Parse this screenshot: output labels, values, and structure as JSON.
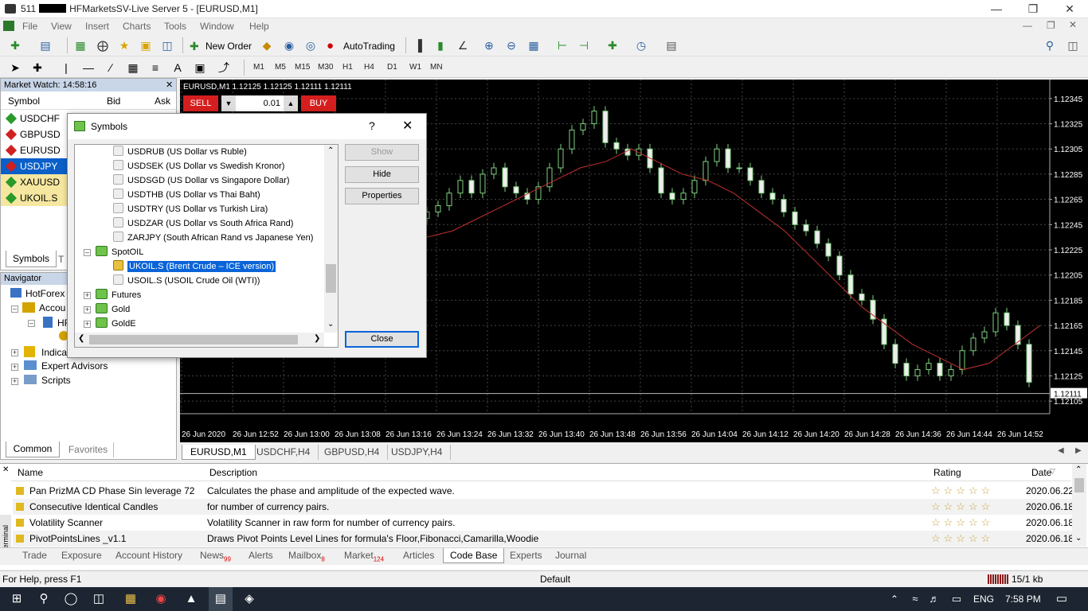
{
  "window": {
    "title_prefix": "511",
    "title": "HFMarketsSV-Live Server 5 - [EURUSD,M1]"
  },
  "menu": [
    "File",
    "View",
    "Insert",
    "Charts",
    "Tools",
    "Window",
    "Help"
  ],
  "toolbar": {
    "new_order": "New Order",
    "autotrading": "AutoTrading"
  },
  "timeframes": [
    "M1",
    "M5",
    "M15",
    "M30",
    "H1",
    "H4",
    "D1",
    "W1",
    "MN"
  ],
  "market_watch": {
    "title": "Market Watch: 14:58:16",
    "col_symbol": "Symbol",
    "col_bid": "Bid",
    "col_ask": "Ask",
    "rows": [
      {
        "symbol": "USDCHF",
        "dir": "up"
      },
      {
        "symbol": "GBPUSD",
        "dir": "down"
      },
      {
        "symbol": "EURUSD",
        "dir": "down"
      },
      {
        "symbol": "USDJPY",
        "dir": "down"
      },
      {
        "symbol": "XAUUSD",
        "dir": "up"
      },
      {
        "symbol": "UKOIL.S",
        "dir": "up"
      }
    ],
    "tab_symbols": "Symbols",
    "tab_t": "T"
  },
  "navigator": {
    "title": "Navigator",
    "root": "HotForex",
    "accounts": "Accou",
    "account_item": "HF",
    "indicators": "Indica",
    "experts": "Expert Advisors",
    "scripts": "Scripts",
    "tab_common": "Common",
    "tab_favorites": "Favorites"
  },
  "chart": {
    "header": "EURUSD,M1  1.12125 1.12125 1.12111 1.12111",
    "sell": "SELL",
    "buy": "BUY",
    "lot": "0.01",
    "price_labels": [
      "1.12345",
      "1.12325",
      "1.12305",
      "1.12285",
      "1.12265",
      "1.12245",
      "1.12225",
      "1.12205",
      "1.12185",
      "1.12165",
      "1.12145",
      "1.12125",
      "1.12105"
    ],
    "current_price": "1.12111",
    "time_labels": [
      "26 Jun 2020",
      "26 Jun 12:52",
      "26 Jun 13:00",
      "26 Jun 13:08",
      "26 Jun 13:16",
      "26 Jun 13:24",
      "26 Jun 13:32",
      "26 Jun 13:40",
      "26 Jun 13:48",
      "26 Jun 13:56",
      "26 Jun 14:04",
      "26 Jun 14:12",
      "26 Jun 14:20",
      "26 Jun 14:28",
      "26 Jun 14:36",
      "26 Jun 14:44",
      "26 Jun 14:52"
    ],
    "tabs": [
      "EURUSD,M1",
      "USDCHF,H4",
      "GBPUSD,H4",
      "USDJPY,H4"
    ]
  },
  "chart_data": {
    "type": "candlestick",
    "series": [
      {
        "name": "EURUSD,M1",
        "close": [
          1.12255,
          1.1226,
          1.1227,
          1.1228,
          1.1227,
          1.12285,
          1.1229,
          1.12275,
          1.1227,
          1.12265,
          1.12275,
          1.1229,
          1.12305,
          1.1232,
          1.12325,
          1.12335,
          1.1231,
          1.12305,
          1.123,
          1.12305,
          1.1229,
          1.1227,
          1.12265,
          1.1227,
          1.1228,
          1.12295,
          1.12305,
          1.1229,
          1.1229,
          1.1228,
          1.1227,
          1.12265,
          1.12255,
          1.12245,
          1.1224,
          1.1223,
          1.1222,
          1.12205,
          1.1219,
          1.12185,
          1.1217,
          1.1215,
          1.12135,
          1.12125,
          1.1213,
          1.12135,
          1.12125,
          1.1213,
          1.12145,
          1.12155,
          1.1216,
          1.12175,
          1.12165,
          1.1215,
          1.1212
        ]
      },
      {
        "name": "MA",
        "values": [
          1.12235,
          1.1224,
          1.1225,
          1.1226,
          1.1227,
          1.1228,
          1.1229,
          1.12295,
          1.12305,
          1.12295,
          1.12285,
          1.1228,
          1.1227,
          1.12255,
          1.1224,
          1.1222,
          1.122,
          1.1218,
          1.12165,
          1.1215,
          1.1214,
          1.1213,
          1.12135,
          1.1215,
          1.12165
        ]
      }
    ]
  },
  "symbols_dialog": {
    "title": "Symbols",
    "help": "?",
    "items": [
      {
        "text": "USDRUB  (US Dollar vs Ruble)"
      },
      {
        "text": "USDSEK  (US Dollar vs Swedish Kronor)"
      },
      {
        "text": "USDSGD  (US Dollar vs Singapore Dollar)"
      },
      {
        "text": "USDTHB  (US Dollar vs Thai Baht)"
      },
      {
        "text": "USDTRY  (US Dollar vs Turkish Lira)"
      },
      {
        "text": "USDZAR  (US Dollar vs South Africa Rand)"
      },
      {
        "text": "ZARJPY  (South African Rand vs Japanese Yen)"
      }
    ],
    "group_spotoil": "SpotOIL",
    "selected": "UKOIL.S  (Brent Crude – ICE version)",
    "usoil": "USOIL.S  (USOIL Crude Oil (WTI))",
    "group_futures": "Futures",
    "group_gold": "Gold",
    "group_golde": "GoldE",
    "btn_show": "Show",
    "btn_hide": "Hide",
    "btn_properties": "Properties",
    "btn_close": "Close"
  },
  "terminal": {
    "col_name": "Name",
    "col_description": "Description",
    "col_rating": "Rating",
    "col_date": "Date",
    "rows": [
      {
        "name": "Pan PrizMA CD Phase Sin leverage 72",
        "description": "Calculates the phase and amplitude of the expected wave.",
        "date": "2020.06.22"
      },
      {
        "name": "Consecutive Identical Candles",
        "description": "for number of currency pairs.",
        "date": "2020.06.18"
      },
      {
        "name": "Volatility Scanner",
        "description": "Volatility Scanner in raw form for number of currency pairs.",
        "date": "2020.06.18"
      },
      {
        "name": "PivotPointsLines _v1.1",
        "description": "Draws Pivot Points Level  Lines for formula's Floor,Fibonacci,Camarilla,Woodie",
        "date": "2020.06.18"
      }
    ],
    "tabs": [
      "Trade",
      "Exposure",
      "Account History",
      "News",
      "Alerts",
      "Mailbox",
      "Market",
      "Articles",
      "Code Base",
      "Experts",
      "Journal"
    ],
    "news_count": "99",
    "mailbox_count": "8",
    "market_count": "124",
    "side_label": "Terminal"
  },
  "status": {
    "help": "For Help, press F1",
    "profile": "Default",
    "traffic": "15/1 kb"
  },
  "taskbar": {
    "lang": "ENG",
    "time": "7:58 PM"
  }
}
